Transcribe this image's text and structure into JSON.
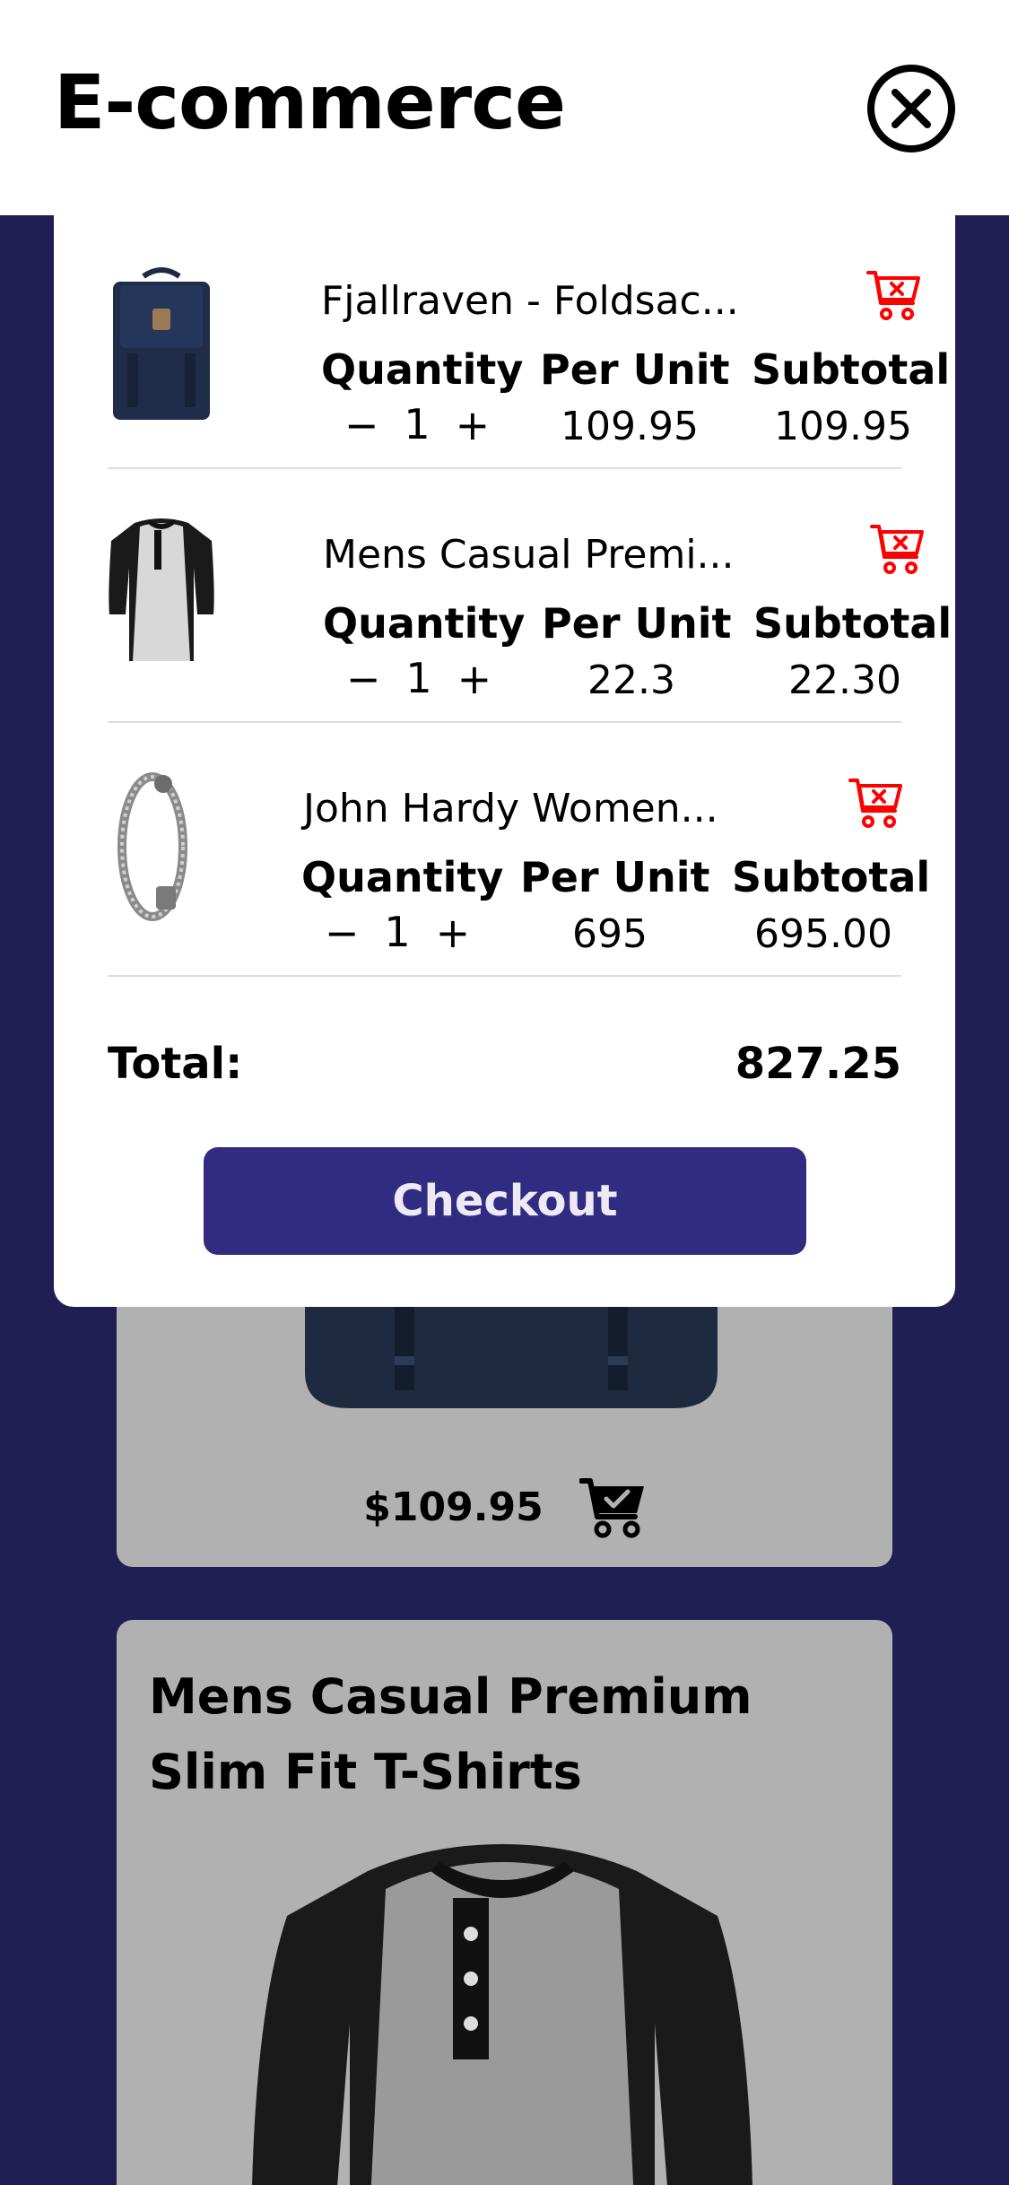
{
  "header": {
    "title": "E-commerce"
  },
  "cart": {
    "columns": {
      "quantity": "Quantity",
      "per_unit": "Per Unit",
      "subtotal": "Subtotal"
    },
    "items": [
      {
        "name": "Fjallraven - Foldsac...",
        "quantity": "1",
        "per_unit": "109.95",
        "subtotal": "109.95",
        "decrement": "−",
        "increment": "+"
      },
      {
        "name": "Mens Casual Premi...",
        "quantity": "1",
        "per_unit": "22.3",
        "subtotal": "22.30",
        "decrement": "−",
        "increment": "+"
      },
      {
        "name": "John Hardy Women...",
        "quantity": "1",
        "per_unit": "695",
        "subtotal": "695.00",
        "decrement": "−",
        "increment": "+"
      }
    ],
    "total_label": "Total:",
    "total_value": "827.25",
    "checkout_label": "Checkout"
  },
  "products": [
    {
      "title": "",
      "price": "$109.95"
    },
    {
      "title": "Mens Casual Premium Slim Fit T-Shirts",
      "price": ""
    }
  ],
  "icons": {
    "close": "close-circle-icon",
    "remove_from_cart": "cart-remove-icon",
    "in_cart": "cart-check-icon"
  },
  "colors": {
    "page_background": "#211e56",
    "checkout_button": "#312c82",
    "remove_icon": "#ff0000",
    "card_background": "#b1b1b1"
  }
}
